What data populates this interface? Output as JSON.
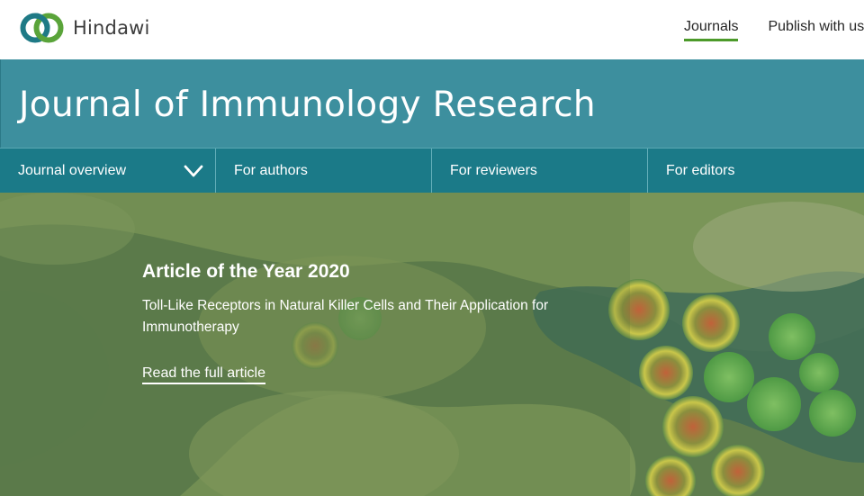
{
  "header": {
    "brand": "Hindawi",
    "logo_icon": "hindawi-rings-logo",
    "nav": [
      {
        "label": "Journals",
        "active": true
      },
      {
        "label": "Publish with us",
        "active": false
      }
    ],
    "accent_color": "#4c9a2a"
  },
  "journal": {
    "title": "Journal of Immunology Research",
    "band_color": "#3d8f9e",
    "nav_color": "#1b7a88",
    "nav": [
      {
        "label": "Journal overview",
        "icon": "chevron-down-icon"
      },
      {
        "label": "For authors"
      },
      {
        "label": "For reviewers"
      },
      {
        "label": "For editors"
      }
    ]
  },
  "hero": {
    "heading": "Article of the Year 2020",
    "description": "Toll-Like Receptors in Natural Killer Cells and Their Application for Immunotherapy",
    "link": "Read the full article"
  }
}
